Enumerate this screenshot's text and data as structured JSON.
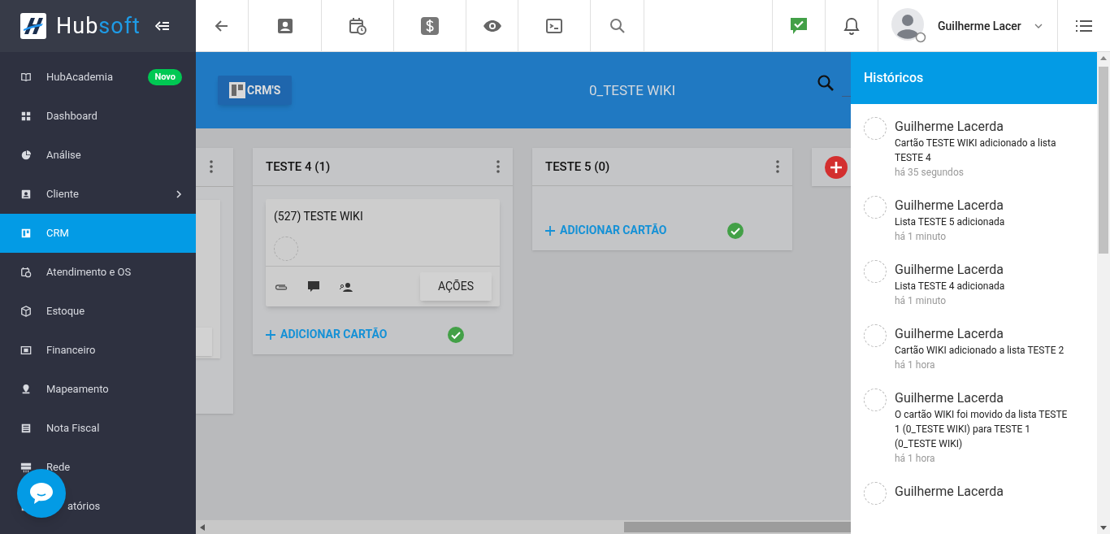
{
  "logo": {
    "text_main": "Hub",
    "text_accent": "soft"
  },
  "topbar": {
    "user_name": "Guilherme Lacer"
  },
  "sidebar": {
    "items": [
      {
        "label": "HubAcademia",
        "badge": "Novo",
        "selected": false
      },
      {
        "label": "Dashboard",
        "selected": false
      },
      {
        "label": "Análise",
        "selected": false
      },
      {
        "label": "Cliente",
        "has_submenu": true,
        "selected": false
      },
      {
        "label": "CRM",
        "selected": true
      },
      {
        "label": "Atendimento e OS",
        "selected": false
      },
      {
        "label": "Estoque",
        "selected": false
      },
      {
        "label": "Financeiro",
        "selected": false
      },
      {
        "label": "Mapeamento",
        "selected": false
      },
      {
        "label": "Nota Fiscal",
        "selected": false
      },
      {
        "label": "Rede",
        "selected": false
      },
      {
        "label": "atórios",
        "selected": false
      }
    ]
  },
  "board_header": {
    "button": "CRM'S",
    "title": "0_TESTE WIKI"
  },
  "lists": [
    {
      "title": "TESTE 4 (1)",
      "cards": [
        {
          "title": "(527) TESTE WIKI",
          "action": "AÇÕES"
        }
      ],
      "add_label": "ADICIONAR CARTÃO"
    },
    {
      "title": "TESTE 5 (0)",
      "add_label": "ADICIONAR CARTÃO"
    }
  ],
  "history": {
    "title": "Históricos",
    "entries": [
      {
        "user": "Guilherme Lacerda",
        "text": "Cartão TESTE WIKI adicionado a lista TESTE 4",
        "time": "há 35 segundos"
      },
      {
        "user": "Guilherme Lacerda",
        "text": "Lista TESTE 5 adicionada",
        "time": "há 1 minuto"
      },
      {
        "user": "Guilherme Lacerda",
        "text": "Lista TESTE 4 adicionada",
        "time": "há 1 minuto"
      },
      {
        "user": "Guilherme Lacerda",
        "text": "Cartão WIKI adicionado a lista TESTE 2",
        "time": "há 1 hora"
      },
      {
        "user": "Guilherme Lacerda",
        "text": "O cartão WIKI foi movido da lista TESTE 1 (0_TESTE WIKI) para TESTE 1 (0_TESTE WIKI)",
        "time": "há 1 hora"
      },
      {
        "user": "Guilherme Lacerda"
      }
    ]
  }
}
